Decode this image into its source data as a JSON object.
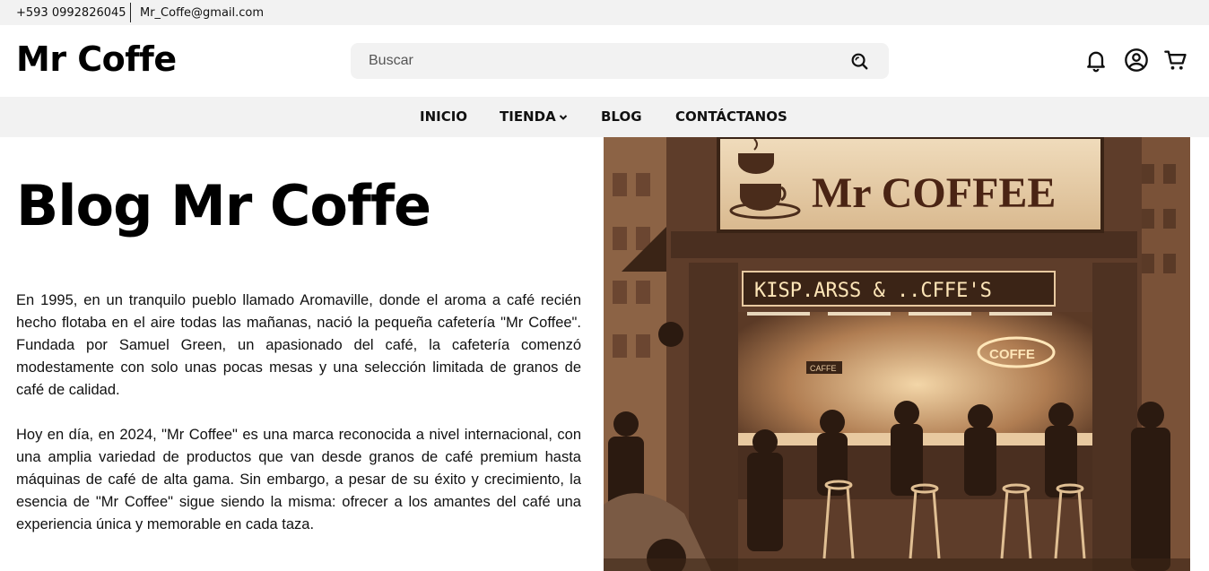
{
  "topbar": {
    "phone": "+593 0992826045",
    "email": "Mr_Coffe@gmail.com"
  },
  "header": {
    "logo": "Mr Coffe",
    "search_placeholder": "Buscar",
    "icons": [
      "bell-icon",
      "user-icon",
      "cart-icon"
    ]
  },
  "nav": {
    "items": [
      "INICIO",
      "TIENDA",
      "BLOG",
      "CONTÁCTANOS"
    ]
  },
  "main": {
    "title": "Blog Mr Coffe",
    "paragraphs": [
      "En 1995, en un tranquilo pueblo llamado Aromaville, donde el aroma a café recién hecho flotaba en el aire todas las mañanas, nació la pequeña cafetería \"Mr Coffee\". Fundada por Samuel Green, un apasionado del café, la cafetería comenzó modestamente con solo unas pocas mesas y una selección limitada de granos de café de calidad.",
      "Hoy en día, en 2024, \"Mr Coffee\" es una marca reconocida a nivel internacional, con una amplia variedad de productos que van desde granos de café premium hasta máquinas de café de alta gama. Sin embargo, a pesar de su éxito y crecimiento, la esencia de \"Mr Coffee\" sigue siendo la misma: ofrecer a los amantes del café una experiencia única y memorable en cada taza."
    ]
  },
  "hero": {
    "sign": "Mr COFFEE",
    "neon": "KISP.ARSS & ..CFFE'S",
    "cup_sign": "COFFE",
    "small_sign": "CAFFE",
    "colors": {
      "sepia_dark": "#3b2418",
      "sepia_mid": "#8a5a3c",
      "sepia_light": "#e8c9a0",
      "neon": "#ffe6b8"
    }
  }
}
